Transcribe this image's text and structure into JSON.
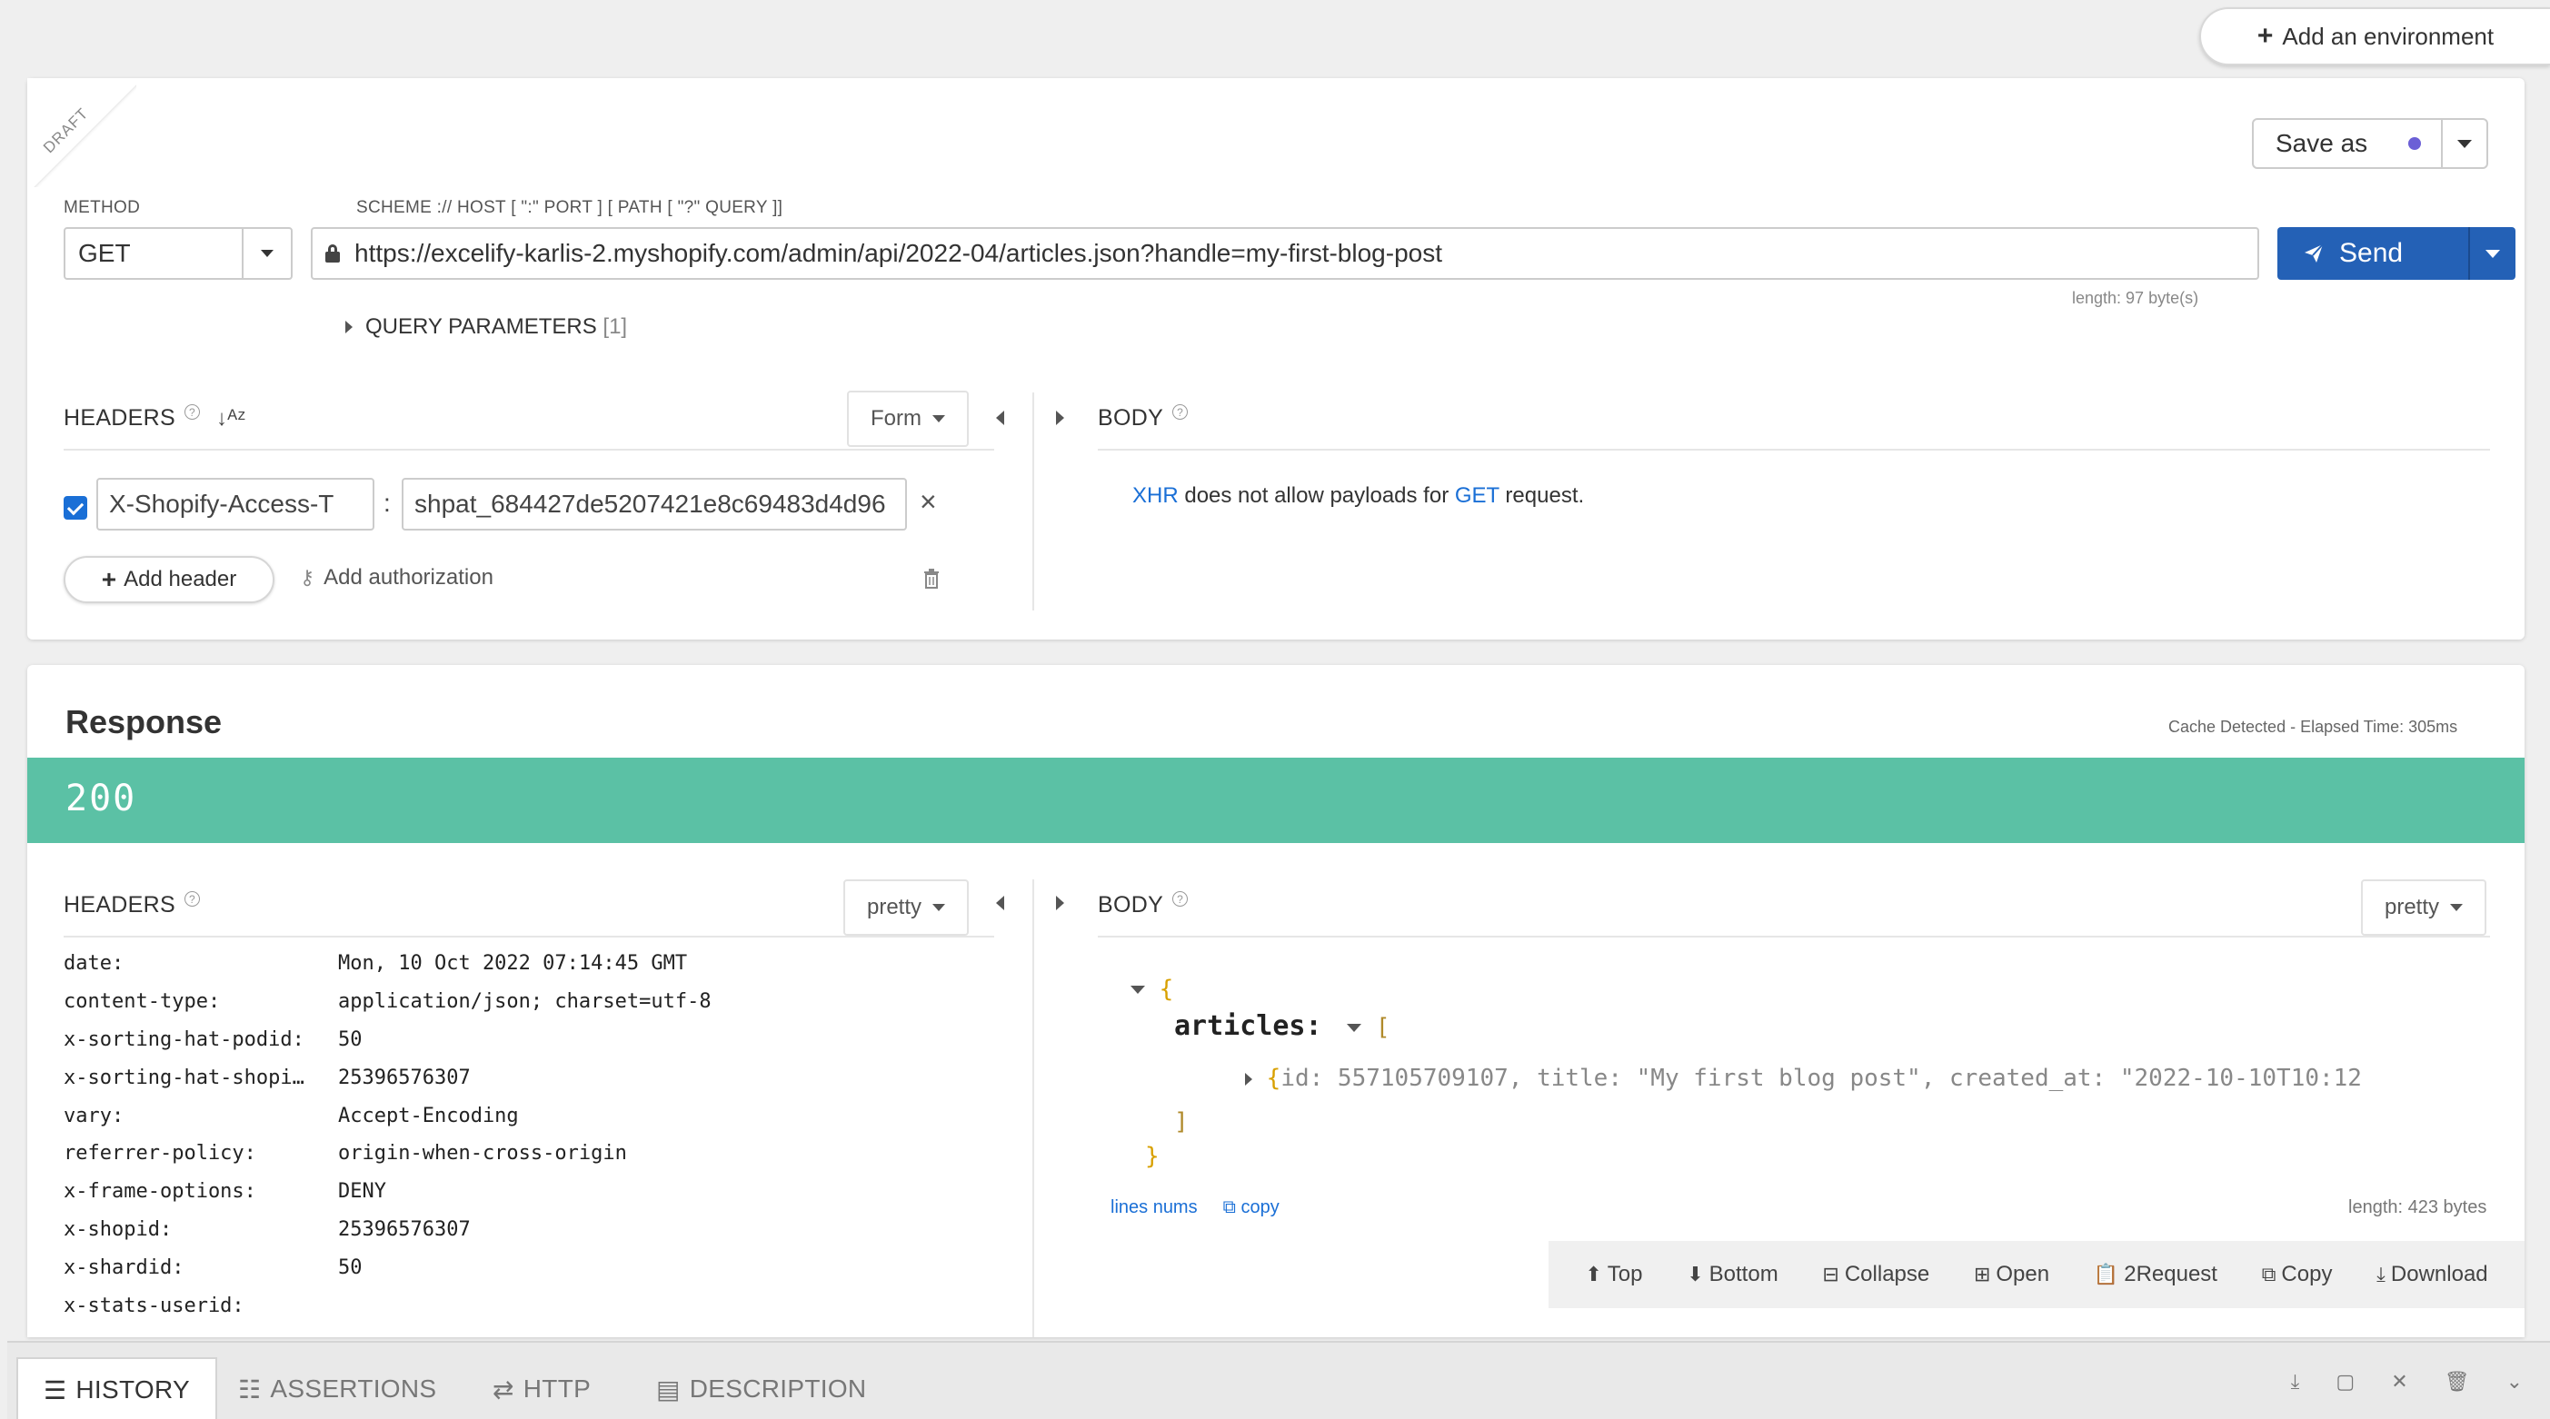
{
  "environment": {
    "add_label": "Add an environment"
  },
  "request": {
    "draft_label": "DRAFT",
    "save_as_label": "Save as",
    "method_label": "METHOD",
    "method_value": "GET",
    "url_label": "SCHEME :// HOST [ \":\" PORT ] [ PATH [ \"?\" QUERY ]]",
    "url_value": "https://excelify-karlis-2.myshopify.com/admin/api/2022-04/articles.json?handle=my-first-blog-post",
    "url_length": "length: 97 byte(s)",
    "send_label": "Send",
    "query_params_label": "QUERY PARAMETERS",
    "query_params_count": "[1]",
    "headers_label": "HEADERS",
    "headers_mode": "Form",
    "header_name": "X-Shopify-Access-T",
    "header_value": "shpat_684427de5207421e8c69483d4d96",
    "add_header_label": "Add header",
    "add_auth_label": "Add authorization",
    "body_label": "BODY",
    "body_message": {
      "xhr": "XHR",
      "mid": " does not allow payloads for ",
      "get": "GET",
      "end": " request."
    }
  },
  "response": {
    "title": "Response",
    "cache_info": "Cache Detected - Elapsed Time: 305ms",
    "status_code": "200",
    "headers_label": "HEADERS",
    "headers_mode": "pretty",
    "body_label": "BODY",
    "body_mode": "pretty",
    "headers": [
      {
        "key": "date:",
        "value": "Mon, 10 Oct 2022 07:14:45 GMT"
      },
      {
        "key": "content-type:",
        "value": "application/json; charset=utf-8"
      },
      {
        "key": "x-sorting-hat-podid:",
        "value": "50"
      },
      {
        "key": "x-sorting-hat-shopi…",
        "value": "25396576307"
      },
      {
        "key": "vary:",
        "value": "Accept-Encoding"
      },
      {
        "key": "referrer-policy:",
        "value": "origin-when-cross-origin"
      },
      {
        "key": "x-frame-options:",
        "value": "DENY"
      },
      {
        "key": "x-shopid:",
        "value": "25396576307"
      },
      {
        "key": "x-shardid:",
        "value": "50"
      },
      {
        "key": "x-stats-userid:",
        "value": ""
      }
    ],
    "json": {
      "open_brace": "{",
      "key": "articles:",
      "open_bracket": "[",
      "item_open": "{",
      "item_text": "id:  557105709107, title:  \"My first blog post\", created_at:  \"2022-10-10T10:12",
      "close_bracket": "]",
      "close_brace": "}"
    },
    "lines_nums_label": "lines nums",
    "copy_label": "copy",
    "length": "length: 423 bytes",
    "toolbar": [
      "Top",
      "Bottom",
      "Collapse",
      "Open",
      "2Request",
      "Copy",
      "Download"
    ]
  },
  "bottom_tabs": [
    "HISTORY",
    "ASSERTIONS",
    "HTTP",
    "DESCRIPTION"
  ],
  "colors": {
    "accent": "#2461b6",
    "status_ok": "#5bc1a5",
    "link": "#1a6fd6"
  }
}
